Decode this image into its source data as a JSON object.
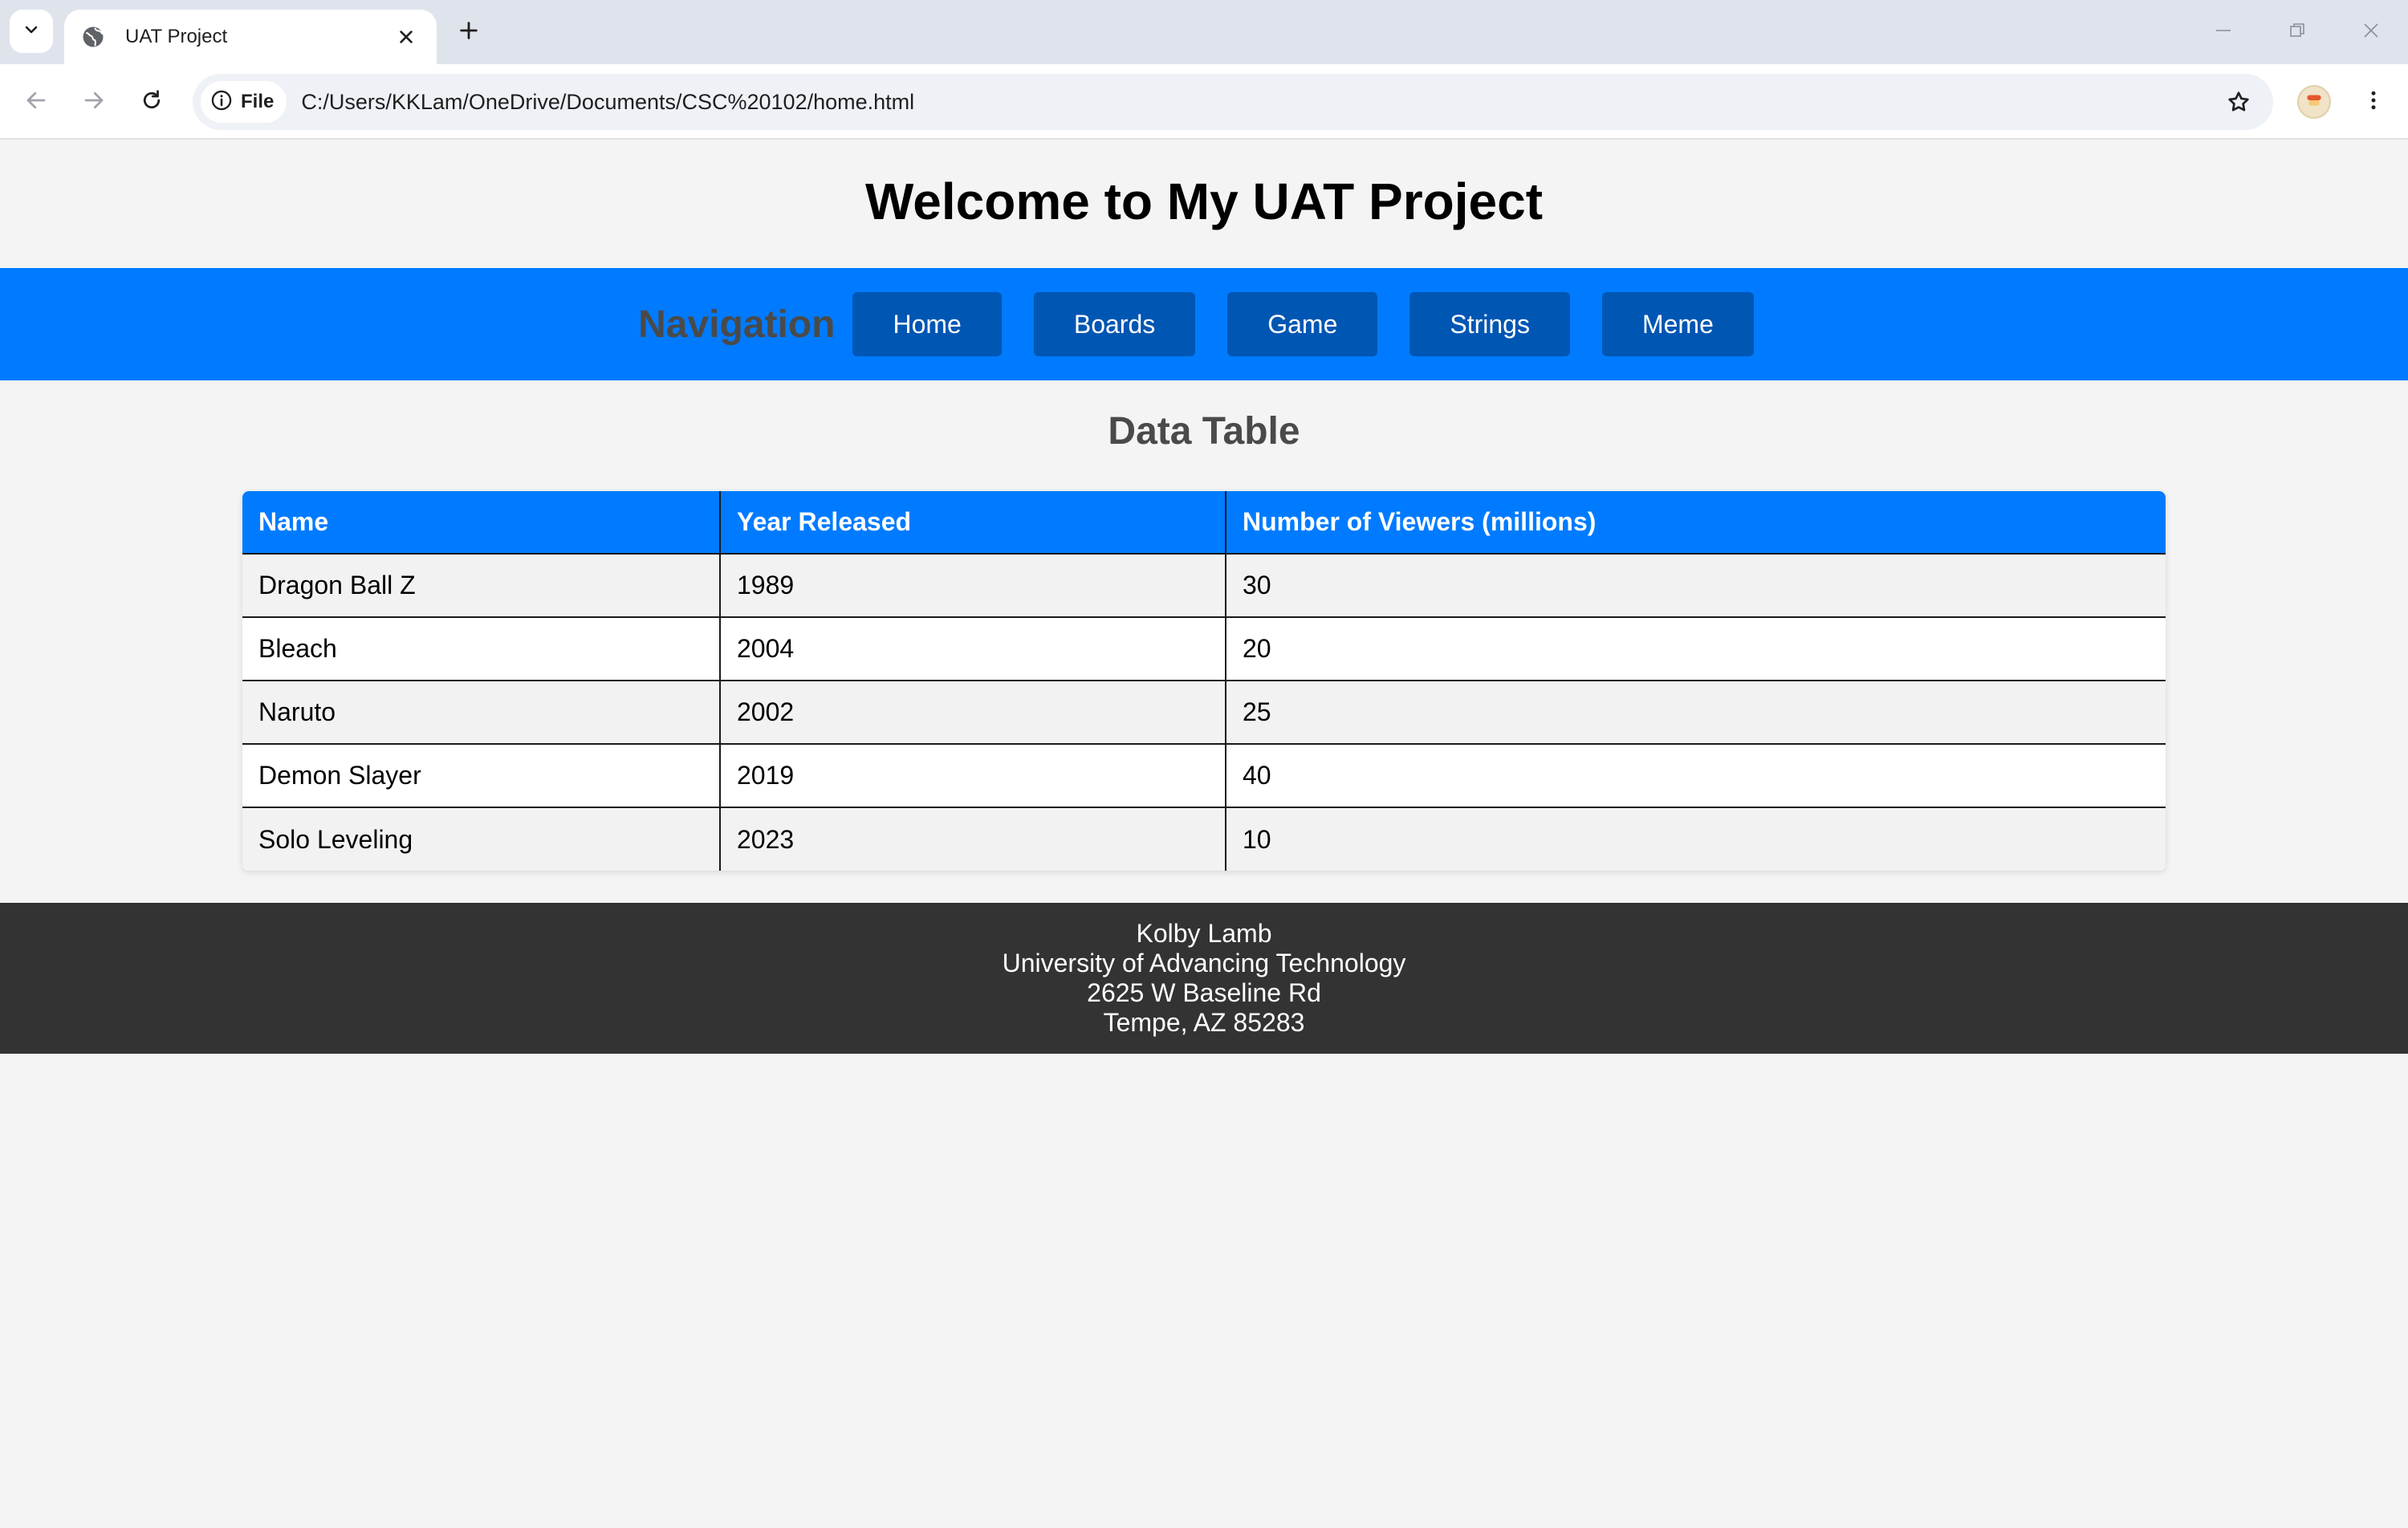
{
  "browser": {
    "tab": {
      "title": "UAT Project"
    },
    "address_bar": {
      "site_info_label": "File",
      "url": "C:/Users/KKLam/OneDrive/Documents/CSC%20102/home.html"
    }
  },
  "page": {
    "title": "Welcome to My UAT Project",
    "navigation": {
      "heading": "Navigation",
      "items": [
        {
          "label": "Home"
        },
        {
          "label": "Boards"
        },
        {
          "label": "Game"
        },
        {
          "label": "Strings"
        },
        {
          "label": "Meme"
        }
      ]
    },
    "data_table": {
      "heading": "Data Table",
      "columns": [
        "Name",
        "Year Released",
        "Number of Viewers (millions)"
      ],
      "rows": [
        [
          "Dragon Ball Z",
          "1989",
          "30"
        ],
        [
          "Bleach",
          "2004",
          "20"
        ],
        [
          "Naruto",
          "2002",
          "25"
        ],
        [
          "Demon Slayer",
          "2019",
          "40"
        ],
        [
          "Solo Leveling",
          "2023",
          "10"
        ]
      ]
    },
    "footer": {
      "lines": [
        "Kolby Lamb",
        "University of Advancing Technology",
        "2625 W Baseline Rd",
        "Tempe, AZ 85283"
      ]
    }
  },
  "colors": {
    "nav_bar": "#007bff",
    "nav_button": "#0056b3",
    "table_header": "#007bff",
    "footer": "#333333",
    "page_background": "#f4f4f4"
  }
}
